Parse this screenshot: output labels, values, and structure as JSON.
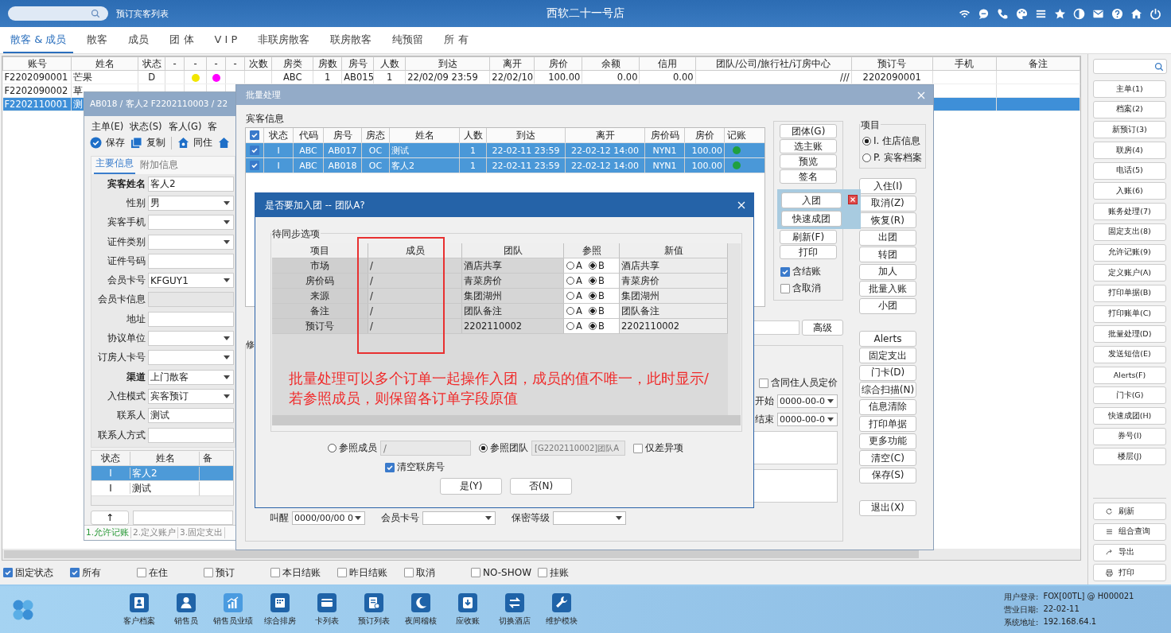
{
  "topbar": {
    "link": "预订宾客列表",
    "title": "西软二十一号店"
  },
  "tabs": [
    {
      "label": "散客 & 成员",
      "selected": true
    },
    {
      "label": "散客",
      "selected": false
    },
    {
      "label": "成员",
      "selected": false
    },
    {
      "label": "团 体",
      "selected": false
    },
    {
      "label": "V I P",
      "selected": false
    },
    {
      "label": "非联房散客",
      "selected": false
    },
    {
      "label": "联房散客",
      "selected": false
    },
    {
      "label": "纯预留",
      "selected": false
    },
    {
      "label": "所 有",
      "selected": false
    }
  ],
  "guest_table": {
    "columns": [
      "账号",
      "姓名",
      "状态",
      "-",
      "-",
      "-",
      "-",
      "次数",
      "房类",
      "房数",
      "房号",
      "人数",
      "到达",
      "离开",
      "房价",
      "余额",
      "信用",
      "团队/公司/旅行社/订房中心",
      "预订号",
      "手机",
      "备注"
    ],
    "rows": [
      {
        "selected": false,
        "cells": [
          "F2202090001",
          "芒果",
          "D",
          null,
          {
            "color": "#f2e600"
          },
          {
            "color": "#ff00ff"
          },
          null,
          null,
          "ABC",
          "1",
          "AB015",
          "1",
          "22/02/09 23:59",
          "22/02/10",
          "100.00",
          "0.00",
          "0.00",
          "///",
          "2202090001"
        ]
      },
      {
        "selected": false,
        "cells": [
          "F2202090002",
          "草"
        ]
      },
      {
        "selected": true,
        "cells": [
          "F2202110001",
          "测"
        ]
      }
    ]
  },
  "filters": [
    {
      "label": "固定状态",
      "checked": true
    },
    {
      "label": "所有",
      "checked": true
    },
    {
      "label": "在住",
      "checked": false
    },
    {
      "label": "预订",
      "checked": false
    },
    {
      "label": "本日结账",
      "checked": false
    },
    {
      "label": "昨日结账",
      "checked": false
    },
    {
      "label": "取消",
      "checked": false
    },
    {
      "label": "NO-SHOW",
      "checked": false
    },
    {
      "label": "挂账",
      "checked": false
    }
  ],
  "side_panel": {
    "buttons": [
      "主单(1)",
      "档案(2)",
      "新预订(3)",
      "联房(4)",
      "电话(5)",
      "入账(6)",
      "账务处理(7)",
      "固定支出(8)",
      "允许记账(9)",
      "定义账户(A)",
      "打印单据(B)",
      "打印账单(C)",
      "批量处理(D)",
      "发送短信(E)",
      "Alerts(F)",
      "门卡(G)",
      "快速成团(H)",
      "券号(I)",
      "楼层(J)"
    ],
    "tools": [
      "刷新",
      "组合查询",
      "导出",
      "打印"
    ]
  },
  "taskbar": {
    "apps": [
      "客户档案",
      "销售员",
      "销售员业绩",
      "综合排房",
      "卡列表",
      "预订列表",
      "夜间稽核",
      "应收账",
      "切换酒店",
      "维护模块"
    ],
    "info": [
      {
        "label": "用户登录:",
        "value": "FOX[00TL] @ H000021"
      },
      {
        "label": "营业日期:",
        "value": "22-02-11"
      },
      {
        "label": "系统地址:",
        "value": "192.168.64.1"
      }
    ]
  },
  "guest_window": {
    "title": "AB018 / 客人2 F2202110003 / 22",
    "menu": [
      "主单(E)",
      "状态(S)",
      "客人(G)",
      "客"
    ],
    "toolbar": [
      "保存",
      "复制",
      "同住"
    ],
    "tabs": [
      {
        "label": "主要信息",
        "selected": true
      },
      {
        "label": "附加信息",
        "selected": false
      }
    ],
    "fields": [
      {
        "label": "宾客姓名",
        "value": "客人2",
        "kind": "text",
        "bold": true
      },
      {
        "label": "性别",
        "value": "男",
        "kind": "select",
        "bold": false
      },
      {
        "label": "宾客手机",
        "kind": "select",
        "bold": false
      },
      {
        "label": "证件类别",
        "kind": "select",
        "bold": false
      },
      {
        "label": "证件号码",
        "kind": "text",
        "bold": false
      },
      {
        "label": "会员卡号",
        "value": "KFGUY1",
        "kind": "select",
        "bold": false
      },
      {
        "label": "会员卡信息",
        "kind": "readonly",
        "bold": false
      },
      {
        "label": "地址",
        "kind": "text",
        "bold": false
      },
      {
        "label": "协议单位",
        "kind": "select",
        "bold": false
      },
      {
        "label": "订房人卡号",
        "kind": "select",
        "bold": false
      },
      {
        "label": "渠道",
        "value": "上门散客",
        "kind": "select",
        "bold": true
      },
      {
        "label": "入住模式",
        "value": "宾客预订",
        "kind": "select",
        "bold": false
      },
      {
        "label": "联系人",
        "value": "测试",
        "kind": "text",
        "bold": false
      },
      {
        "label": "联系人方式",
        "kind": "text",
        "bold": false
      }
    ],
    "grid": {
      "columns": [
        "状态",
        "姓名",
        "备"
      ],
      "rows": [
        {
          "status": "I",
          "name": "客人2",
          "selected": true
        },
        {
          "status": "I",
          "name": "测试",
          "selected": false
        }
      ]
    },
    "up_button": "↑",
    "bottom_tabs": [
      {
        "label": "1.允许记账",
        "selected": true
      },
      {
        "label": "2.定义账户",
        "selected": false
      },
      {
        "label": "3.固定支出",
        "selected": false
      }
    ]
  },
  "batch_window": {
    "title": "批量处理",
    "group": "宾客信息",
    "all_checked": true,
    "columns": [
      "状态",
      "代码",
      "房号",
      "房态",
      "姓名",
      "人数",
      "到达",
      "离开",
      "房价码",
      "房价",
      "记账"
    ],
    "rows": [
      {
        "checked": true,
        "selected": true,
        "posted": true,
        "cells": [
          "I",
          "ABC",
          "AB017",
          "OC",
          "测试",
          "1",
          "22-02-11 23:59",
          "22-02-12 14:00",
          "NYN1",
          "100.00"
        ]
      },
      {
        "checked": true,
        "selected": true,
        "posted": true,
        "cells": [
          "I",
          "ABC",
          "AB018",
          "OC",
          "客人2",
          "1",
          "22-02-11 23:59",
          "22-02-12 14:00",
          "NYN1",
          "100.00"
        ]
      }
    ],
    "side_buttons": [
      "团体(G)",
      "选主账",
      "预览",
      "签名",
      "刷新(F)",
      "打印"
    ],
    "options": [
      {
        "label": "含结账",
        "checked": true
      },
      {
        "label": "含取消",
        "checked": false
      }
    ],
    "project": {
      "title": "项目",
      "options": [
        {
          "label": "I. 住店信息",
          "selected": true
        },
        {
          "label": "P. 宾客档案",
          "selected": false
        }
      ]
    },
    "action_buttons": [
      "入住(I)",
      "取消(Z)",
      "恢复(R)",
      "出团",
      "转团",
      "加人",
      "批量入账",
      "小团"
    ],
    "more_buttons": [
      "Alerts",
      "固定支出",
      "门卡(D)",
      "综合扫描(N)",
      "信息清除",
      "打印单据",
      "更多功能",
      "清空(C)",
      "保存(S)"
    ],
    "exit_button": "退出(X)",
    "advanced_button": "高级",
    "section_label": "修",
    "cohabit": {
      "label": "含同住人员定价",
      "checked": false
    },
    "dates": [
      {
        "label": "开始",
        "value": "0000-00-0"
      },
      {
        "label": "结束",
        "value": "0000-00-0"
      }
    ],
    "bottom_fields": [
      {
        "label": "叫醒",
        "value": "0000/00/00 0"
      },
      {
        "label": "会员卡号"
      },
      {
        "label": "保密等级"
      }
    ]
  },
  "popup": {
    "items": [
      "入团",
      "快速成团"
    ]
  },
  "join_dialog": {
    "title": "是否要加入团 -- 团队A?",
    "group": "待同步选项",
    "columns": [
      "项目",
      "成员",
      "团队",
      "参照",
      "新值"
    ],
    "rows": [
      {
        "item": "市场",
        "member": "/",
        "team": "酒店共享",
        "options": [
          {
            "label": "A",
            "selected": false
          },
          {
            "label": "B",
            "selected": true
          }
        ],
        "new": "酒店共享"
      },
      {
        "item": "房价码",
        "member": "/",
        "team": "青菜房价",
        "options": [
          {
            "label": "A",
            "selected": false
          },
          {
            "label": "B",
            "selected": true
          }
        ],
        "new": "青菜房价"
      },
      {
        "item": "来源",
        "member": "/",
        "team": "集团湖州",
        "options": [
          {
            "label": "A",
            "selected": false
          },
          {
            "label": "B",
            "selected": true
          }
        ],
        "new": "集团湖州"
      },
      {
        "item": "备注",
        "member": "/",
        "team": "团队备注",
        "options": [
          {
            "label": "A",
            "selected": false
          },
          {
            "label": "B",
            "selected": true
          }
        ],
        "new": "团队备注"
      },
      {
        "item": "预订号",
        "member": "/",
        "team": "2202110002",
        "options": [
          {
            "label": "A",
            "selected": false
          },
          {
            "label": "B",
            "selected": true
          }
        ],
        "new": "2202110002"
      }
    ],
    "note": [
      "批量处理可以多个订单一起操作入团，成员的值不唯一，此时显示/",
      "若参照成员，则保留各订单字段原值"
    ],
    "refs": [
      {
        "label": "参照成员",
        "selected": false,
        "value": "/"
      },
      {
        "label": "参照团队",
        "selected": true,
        "value": "[G2202110002]团队A"
      }
    ],
    "diff_only": {
      "label": "仅差异项",
      "checked": false
    },
    "clear_link": {
      "label": "清空联房号",
      "checked": true
    },
    "buttons": [
      "是(Y)",
      "否(N)"
    ]
  }
}
